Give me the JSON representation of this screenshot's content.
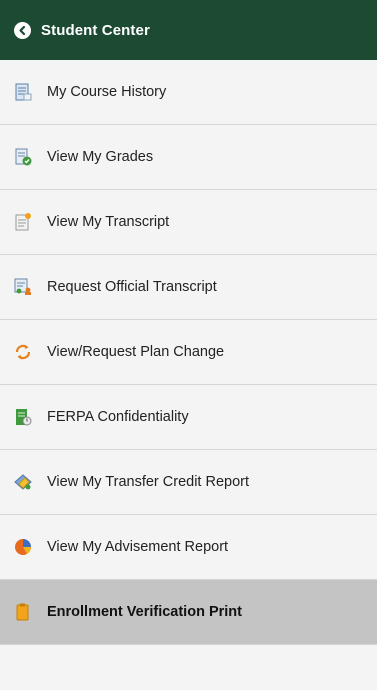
{
  "header": {
    "title": "Student Center",
    "back_icon": "circle-chevron-left-icon",
    "background": "#1d4a33"
  },
  "menu": {
    "items": [
      {
        "label": "My Course History",
        "icon": "course-history-icon"
      },
      {
        "label": "View My Grades",
        "icon": "grades-icon"
      },
      {
        "label": "View My Transcript",
        "icon": "transcript-icon"
      },
      {
        "label": "Request Official Transcript",
        "icon": "request-transcript-icon"
      },
      {
        "label": "View/Request Plan Change",
        "icon": "plan-change-icon"
      },
      {
        "label": "FERPA Confidentiality",
        "icon": "ferpa-icon"
      },
      {
        "label": "View My Transfer Credit Report",
        "icon": "transfer-credit-icon"
      },
      {
        "label": "View My Advisement Report",
        "icon": "advisement-report-icon"
      },
      {
        "label": "Enrollment Verification Print",
        "icon": "enrollment-verification-icon",
        "selected": true
      }
    ]
  },
  "colors": {
    "header_bg": "#1d4a33",
    "item_bg": "#f4f4f4",
    "selected_bg": "#c4c4c4",
    "divider": "#d6d6d6"
  }
}
